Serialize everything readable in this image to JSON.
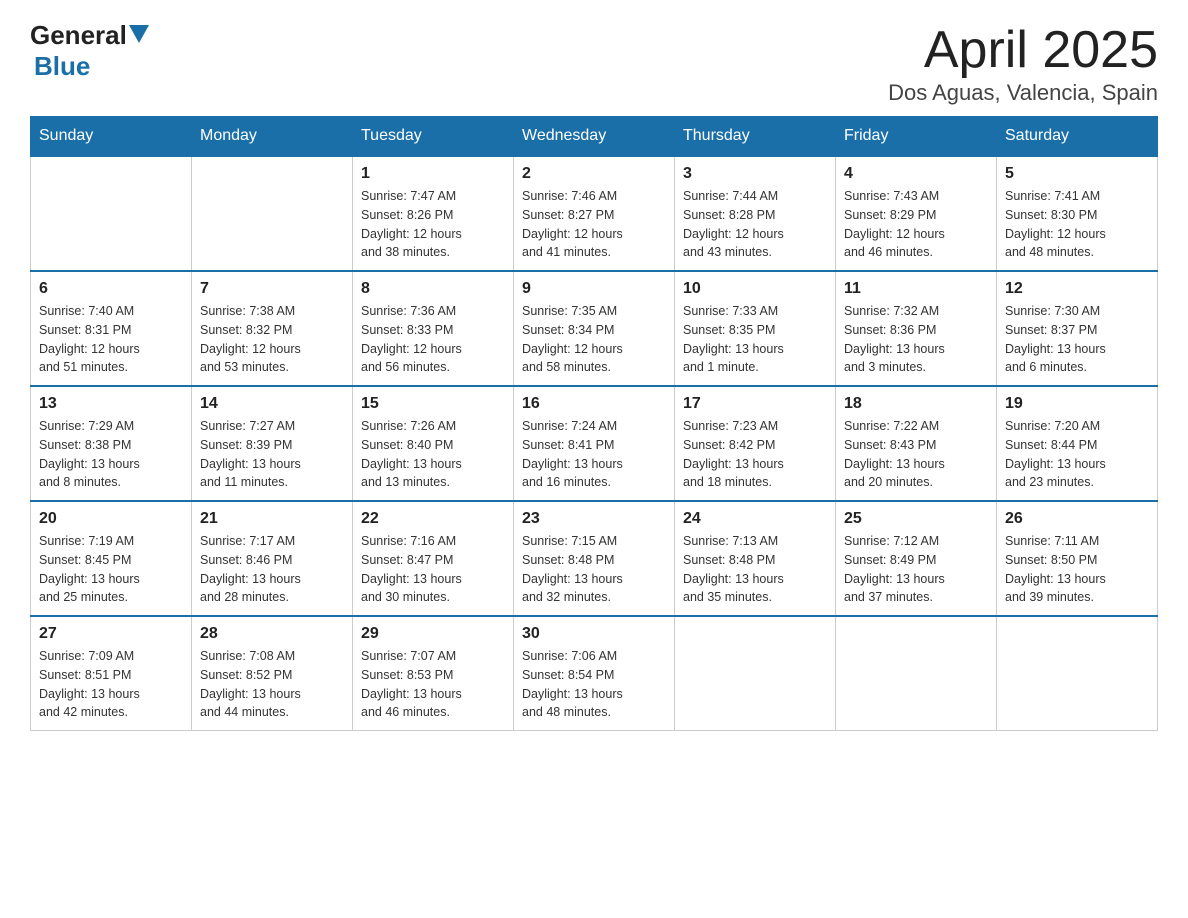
{
  "header": {
    "logo_general": "General",
    "logo_blue": "Blue",
    "title": "April 2025",
    "subtitle": "Dos Aguas, Valencia, Spain"
  },
  "weekdays": [
    "Sunday",
    "Monday",
    "Tuesday",
    "Wednesday",
    "Thursday",
    "Friday",
    "Saturday"
  ],
  "weeks": [
    [
      {
        "day": "",
        "info": ""
      },
      {
        "day": "",
        "info": ""
      },
      {
        "day": "1",
        "info": "Sunrise: 7:47 AM\nSunset: 8:26 PM\nDaylight: 12 hours\nand 38 minutes."
      },
      {
        "day": "2",
        "info": "Sunrise: 7:46 AM\nSunset: 8:27 PM\nDaylight: 12 hours\nand 41 minutes."
      },
      {
        "day": "3",
        "info": "Sunrise: 7:44 AM\nSunset: 8:28 PM\nDaylight: 12 hours\nand 43 minutes."
      },
      {
        "day": "4",
        "info": "Sunrise: 7:43 AM\nSunset: 8:29 PM\nDaylight: 12 hours\nand 46 minutes."
      },
      {
        "day": "5",
        "info": "Sunrise: 7:41 AM\nSunset: 8:30 PM\nDaylight: 12 hours\nand 48 minutes."
      }
    ],
    [
      {
        "day": "6",
        "info": "Sunrise: 7:40 AM\nSunset: 8:31 PM\nDaylight: 12 hours\nand 51 minutes."
      },
      {
        "day": "7",
        "info": "Sunrise: 7:38 AM\nSunset: 8:32 PM\nDaylight: 12 hours\nand 53 minutes."
      },
      {
        "day": "8",
        "info": "Sunrise: 7:36 AM\nSunset: 8:33 PM\nDaylight: 12 hours\nand 56 minutes."
      },
      {
        "day": "9",
        "info": "Sunrise: 7:35 AM\nSunset: 8:34 PM\nDaylight: 12 hours\nand 58 minutes."
      },
      {
        "day": "10",
        "info": "Sunrise: 7:33 AM\nSunset: 8:35 PM\nDaylight: 13 hours\nand 1 minute."
      },
      {
        "day": "11",
        "info": "Sunrise: 7:32 AM\nSunset: 8:36 PM\nDaylight: 13 hours\nand 3 minutes."
      },
      {
        "day": "12",
        "info": "Sunrise: 7:30 AM\nSunset: 8:37 PM\nDaylight: 13 hours\nand 6 minutes."
      }
    ],
    [
      {
        "day": "13",
        "info": "Sunrise: 7:29 AM\nSunset: 8:38 PM\nDaylight: 13 hours\nand 8 minutes."
      },
      {
        "day": "14",
        "info": "Sunrise: 7:27 AM\nSunset: 8:39 PM\nDaylight: 13 hours\nand 11 minutes."
      },
      {
        "day": "15",
        "info": "Sunrise: 7:26 AM\nSunset: 8:40 PM\nDaylight: 13 hours\nand 13 minutes."
      },
      {
        "day": "16",
        "info": "Sunrise: 7:24 AM\nSunset: 8:41 PM\nDaylight: 13 hours\nand 16 minutes."
      },
      {
        "day": "17",
        "info": "Sunrise: 7:23 AM\nSunset: 8:42 PM\nDaylight: 13 hours\nand 18 minutes."
      },
      {
        "day": "18",
        "info": "Sunrise: 7:22 AM\nSunset: 8:43 PM\nDaylight: 13 hours\nand 20 minutes."
      },
      {
        "day": "19",
        "info": "Sunrise: 7:20 AM\nSunset: 8:44 PM\nDaylight: 13 hours\nand 23 minutes."
      }
    ],
    [
      {
        "day": "20",
        "info": "Sunrise: 7:19 AM\nSunset: 8:45 PM\nDaylight: 13 hours\nand 25 minutes."
      },
      {
        "day": "21",
        "info": "Sunrise: 7:17 AM\nSunset: 8:46 PM\nDaylight: 13 hours\nand 28 minutes."
      },
      {
        "day": "22",
        "info": "Sunrise: 7:16 AM\nSunset: 8:47 PM\nDaylight: 13 hours\nand 30 minutes."
      },
      {
        "day": "23",
        "info": "Sunrise: 7:15 AM\nSunset: 8:48 PM\nDaylight: 13 hours\nand 32 minutes."
      },
      {
        "day": "24",
        "info": "Sunrise: 7:13 AM\nSunset: 8:48 PM\nDaylight: 13 hours\nand 35 minutes."
      },
      {
        "day": "25",
        "info": "Sunrise: 7:12 AM\nSunset: 8:49 PM\nDaylight: 13 hours\nand 37 minutes."
      },
      {
        "day": "26",
        "info": "Sunrise: 7:11 AM\nSunset: 8:50 PM\nDaylight: 13 hours\nand 39 minutes."
      }
    ],
    [
      {
        "day": "27",
        "info": "Sunrise: 7:09 AM\nSunset: 8:51 PM\nDaylight: 13 hours\nand 42 minutes."
      },
      {
        "day": "28",
        "info": "Sunrise: 7:08 AM\nSunset: 8:52 PM\nDaylight: 13 hours\nand 44 minutes."
      },
      {
        "day": "29",
        "info": "Sunrise: 7:07 AM\nSunset: 8:53 PM\nDaylight: 13 hours\nand 46 minutes."
      },
      {
        "day": "30",
        "info": "Sunrise: 7:06 AM\nSunset: 8:54 PM\nDaylight: 13 hours\nand 48 minutes."
      },
      {
        "day": "",
        "info": ""
      },
      {
        "day": "",
        "info": ""
      },
      {
        "day": "",
        "info": ""
      }
    ]
  ]
}
